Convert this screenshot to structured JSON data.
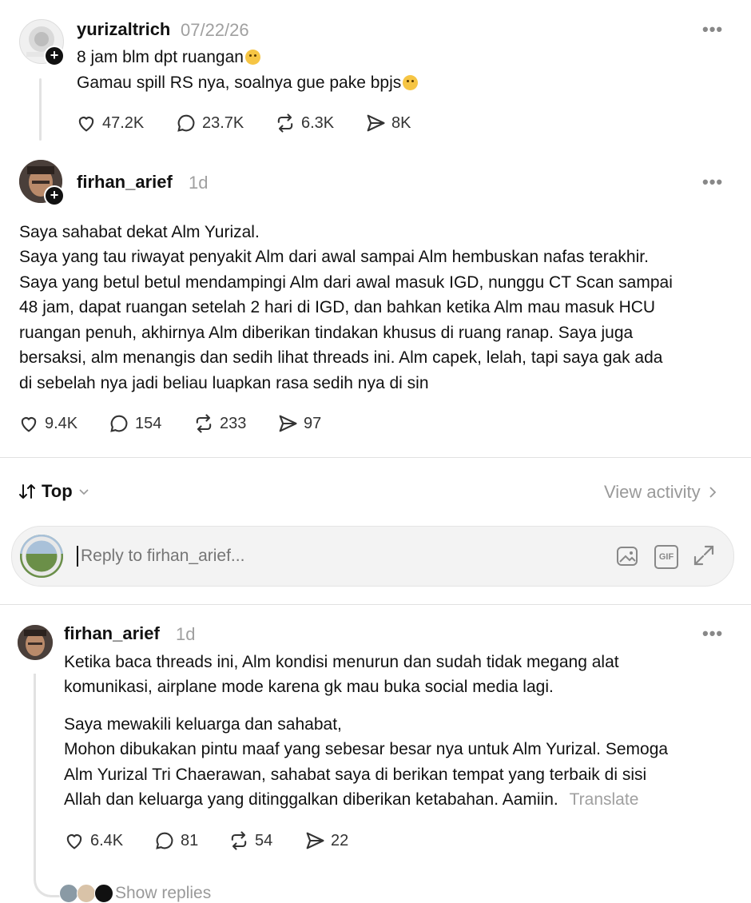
{
  "posts": [
    {
      "username": "yurizaltrich",
      "time": "07/22/26",
      "lines": [
        "8 jam blm dpt ruangan",
        "Gamau spill RS nya, soalnya gue pake bpjs"
      ],
      "likes": "47.2K",
      "comments": "23.7K",
      "reposts": "6.3K",
      "shares": "8K"
    },
    {
      "username": "firhan_arief",
      "time": "1d",
      "lines": [
        "Saya sahabat dekat Alm Yurizal.",
        "Saya yang tau riwayat penyakit Alm dari awal sampai Alm hembuskan nafas terakhir.",
        "Saya yang betul betul mendampingi Alm dari awal masuk IGD, nunggu CT Scan sampai",
        "48 jam, dapat ruangan setelah 2 hari di IGD, dan bahkan ketika Alm mau masuk HCU",
        "ruangan penuh, akhirnya Alm diberikan tindakan khusus di ruang ranap. Saya juga",
        "bersaksi, alm menangis dan sedih lihat threads ini. Alm capek, lelah, tapi saya gak ada",
        "di sebelah nya jadi beliau luapkan rasa sedih nya di sin"
      ],
      "likes": "9.4K",
      "comments": "154",
      "reposts": "233",
      "shares": "97"
    }
  ],
  "sort": {
    "label": "Top",
    "view_activity": "View activity"
  },
  "reply_input": {
    "placeholder": "Reply to firhan_arief..."
  },
  "reply": {
    "username": "firhan_arief",
    "time": "1d",
    "para1": [
      "Ketika baca threads ini, Alm kondisi menurun dan sudah tidak megang alat",
      "komunikasi, airplane mode karena gk mau buka social media lagi."
    ],
    "para2": [
      "Saya mewakili keluarga dan sahabat,",
      "Mohon dibukakan pintu maaf yang sebesar besar nya untuk Alm Yurizal. Semoga",
      "Alm Yurizal Tri Chaerawan, sahabat saya di berikan tempat yang terbaik di sisi",
      "Allah dan keluarga yang ditinggalkan diberikan ketabahan. Aamiin."
    ],
    "translate": "Translate",
    "likes": "6.4K",
    "comments": "81",
    "reposts": "54",
    "shares": "22",
    "show_replies": "Show replies"
  }
}
